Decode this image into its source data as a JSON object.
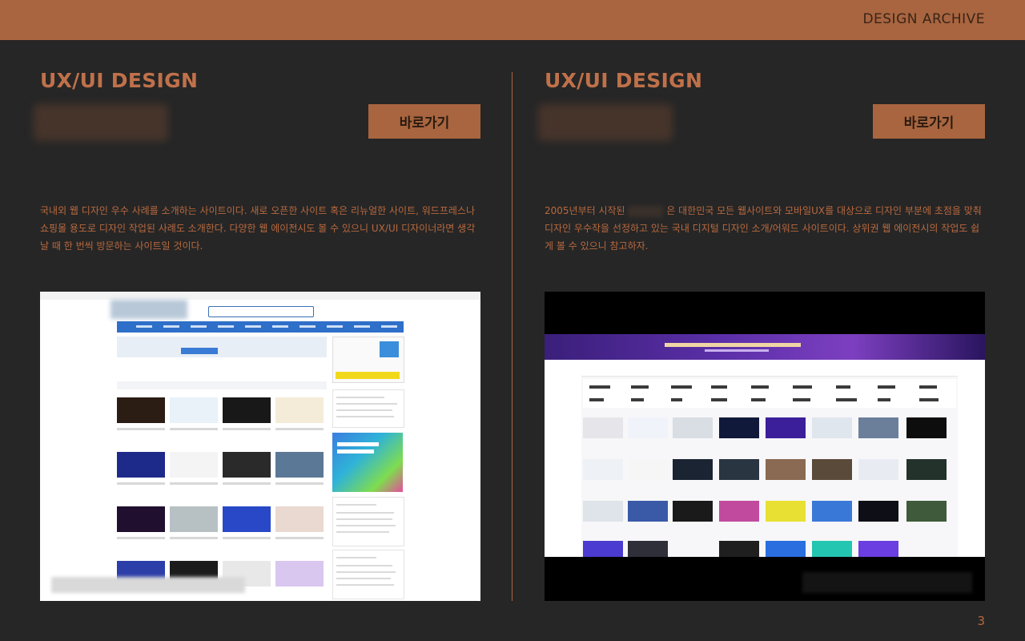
{
  "header": {
    "brand": "DESIGN ARCHIVE"
  },
  "sections": [
    {
      "title": "UX/UI DESIGN",
      "button_label": "바로가기",
      "description": "국내외 웹 디자인 우수 사례를 소개하는 사이트이다. 새로 오픈한 사이트 혹은 리뉴얼한 사이트, 워드프레스나 쇼핑몰 용도로 디자인 작업된 사례도 소개한다. 다양한 웹 에이전시도 볼 수 있으니 UX/UI 디자이너라면 생각날 때 한 번씩 방문하는 사이트일 것이다."
    },
    {
      "title": "UX/UI DESIGN",
      "button_label": "바로가기",
      "description_before": "2005년부터 시작된",
      "description_after": "은 대한민국 모든 웹사이트와 모바일UX를 대상으로 디자인 부분에 초점을 맞춰 디자인 우수작을 선정하고 있는 국내 디지털 디자인 소개/어워드 사이트이다. 상위권 웹 에이전시의 작업도 쉽게 볼 수 있으니 참고하자."
    }
  ],
  "page_number": "3",
  "colors": {
    "background": "#262626",
    "accent": "#a8653f",
    "title": "#c0714a",
    "text": "#b8693f"
  }
}
